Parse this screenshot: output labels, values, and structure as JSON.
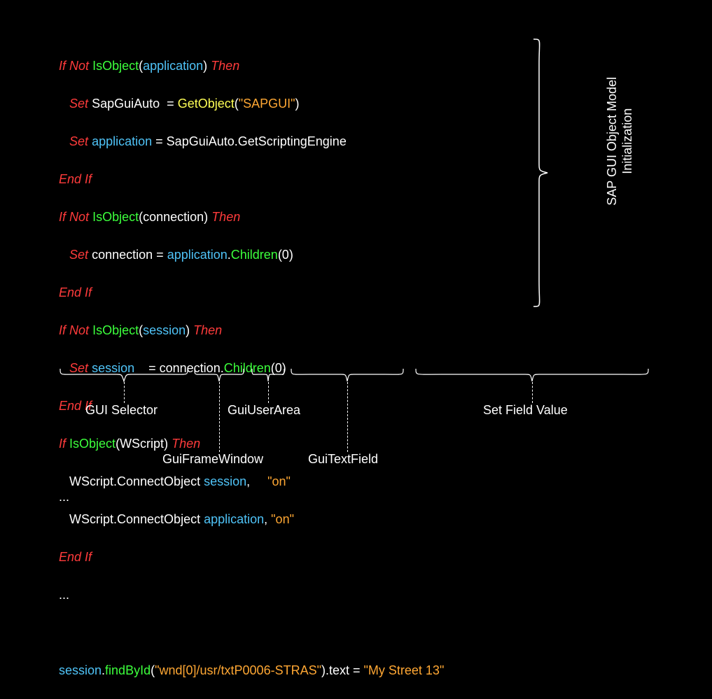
{
  "code": {
    "l1": {
      "k1": "If",
      "k2": "Not",
      "fn": "IsObject",
      "arg": "application",
      "k3": "Then"
    },
    "l2": {
      "k1": "Set",
      "id": "SapGuiAuto",
      "eq": "=",
      "fn": "GetObject",
      "str": "\"SAPGUI\""
    },
    "l3": {
      "k1": "Set",
      "id": "application",
      "eq": "=",
      "rhs1": "SapGuiAuto.GetScriptingEngine"
    },
    "l4": {
      "k1": "End",
      "k2": "If"
    },
    "l5": {
      "k1": "If",
      "k2": "Not",
      "fn": "IsObject",
      "arg": "connection",
      "k3": "Then"
    },
    "l6": {
      "k1": "Set",
      "id": "connection",
      "eq": "=",
      "obj": "application",
      "dot": ".",
      "method": "Children",
      "args": "(0)"
    },
    "l7": {
      "k1": "End",
      "k2": "If"
    },
    "l8": {
      "k1": "If",
      "k2": "Not",
      "fn": "IsObject",
      "arg": "session",
      "k3": "Then"
    },
    "l9": {
      "k1": "Set",
      "id": "session",
      "eq": "=",
      "obj": "connection",
      "dot": ".",
      "method": "Children",
      "args": "(0)"
    },
    "l10": {
      "k1": "End",
      "k2": "If"
    },
    "l11": {
      "k1": "If",
      "fn": "IsObject",
      "arg": "WScript",
      "k3": "Then"
    },
    "l12": {
      "txt1": "WScript.ConnectObject ",
      "id": "session",
      "comma": ",     ",
      "str": "\"on\""
    },
    "l13": {
      "txt1": "WScript.ConnectObject ",
      "id": "application",
      "comma": ", ",
      "str": "\"on\""
    },
    "l14": {
      "k1": "End",
      "k2": "If"
    },
    "l15": "...",
    "l17": {
      "obj": "session",
      "dot": ".",
      "method": "findById",
      "lp": "(",
      "str1": "\"wnd[0]/usr/txtP0006-STRAS\"",
      "rp": ")",
      "tail": ".text = ",
      "str2": "\"My Street 13\""
    },
    "l_end": "..."
  },
  "annotations": {
    "right_label_line1": "SAP GUI Object Model",
    "right_label_line2": "Initialization",
    "gui_selector": "GUI Selector",
    "gui_frame_window": "GuiFrameWindow",
    "gui_user_area": "GuiUserArea",
    "gui_text_field": "GuiTextField",
    "set_field_value": "Set Field Value"
  }
}
